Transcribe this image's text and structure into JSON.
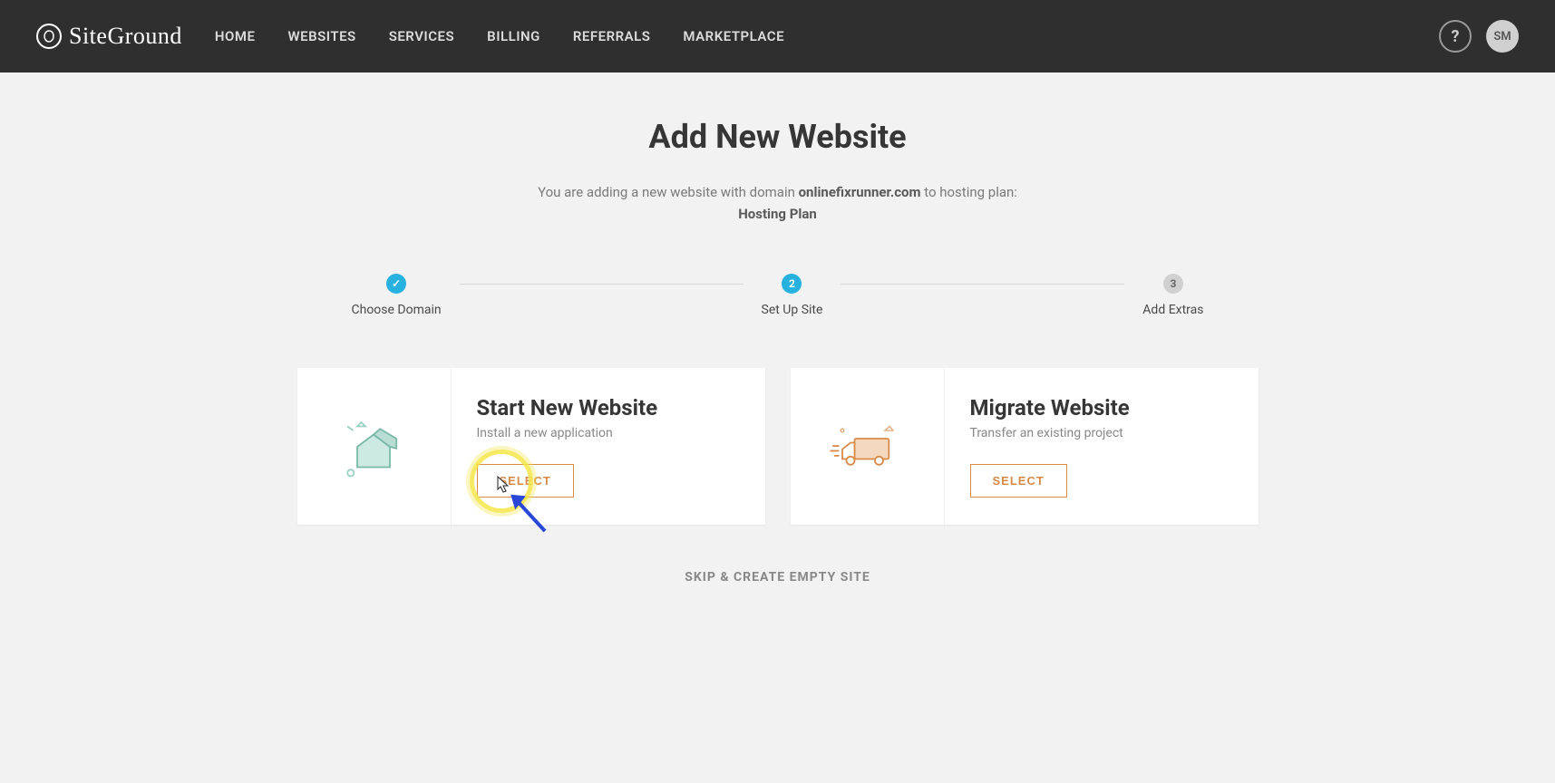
{
  "header": {
    "brand": "SiteGround",
    "nav": [
      "HOME",
      "WEBSITES",
      "SERVICES",
      "BILLING",
      "REFERRALS",
      "MARKETPLACE"
    ],
    "help_glyph": "?",
    "avatar_initials": "SM"
  },
  "page": {
    "title": "Add New Website",
    "subtitle_prefix": "You are adding a new website with domain ",
    "subtitle_domain": "onlinefixrunner.com",
    "subtitle_suffix": " to hosting plan:",
    "hosting_plan": "Hosting Plan"
  },
  "steps": [
    {
      "label": "Choose Domain",
      "state": "done",
      "num": ""
    },
    {
      "label": "Set Up Site",
      "state": "current",
      "num": "2"
    },
    {
      "label": "Add Extras",
      "state": "pending",
      "num": "3"
    }
  ],
  "cards": {
    "start": {
      "title": "Start New Website",
      "desc": "Install a new application",
      "button": "SELECT"
    },
    "migrate": {
      "title": "Migrate Website",
      "desc": "Transfer an existing project",
      "button": "SELECT"
    }
  },
  "skip_label": "SKIP & CREATE EMPTY SITE"
}
